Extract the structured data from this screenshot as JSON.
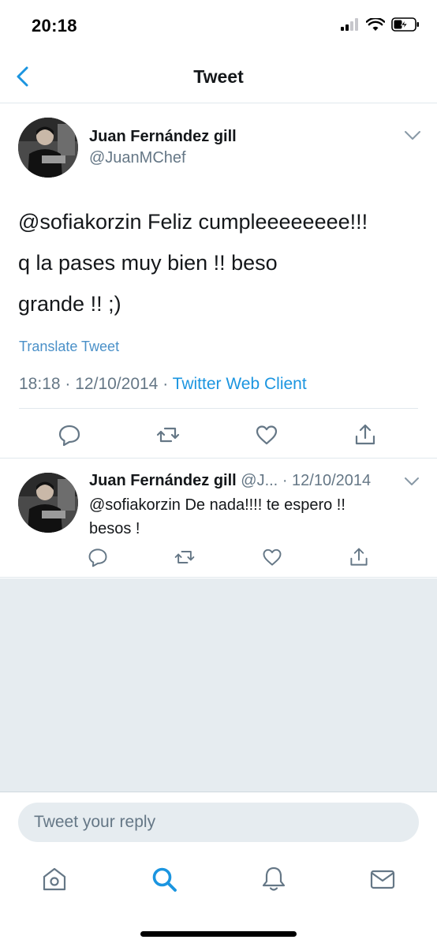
{
  "status_bar": {
    "time": "20:18",
    "battery_percent": 40
  },
  "nav": {
    "title": "Tweet"
  },
  "tweet": {
    "author_name": "Juan Fernández gill",
    "author_handle": "@JuanMChef",
    "text_lines": [
      "@sofiakorzin Feliz cumpleeeeeeee!!!",
      "q la pases muy bien !! beso",
      "grande !! ;)"
    ],
    "translate_label": "Translate Tweet",
    "time": "18:18",
    "separator": "·",
    "date": "12/10/2014",
    "client": "Twitter Web Client"
  },
  "reply": {
    "author_name": "Juan Fernández gill",
    "author_handle": "@J...",
    "date": "· 12/10/2014",
    "text_lines": [
      "@sofiakorzin De nada!!!! te espero !!",
      "besos !"
    ]
  },
  "reply_bar": {
    "placeholder": "Tweet your reply"
  },
  "colors": {
    "accent": "#1b95e0",
    "link": "#4a90c8",
    "secondary_text": "#657786",
    "divider": "#e1e8ed",
    "gray_background": "#e6ecf0",
    "icon_gray": "#657786"
  },
  "icons": {
    "back": "chevron-left-icon",
    "reply": "comment-icon",
    "retweet": "retweet-icon",
    "like": "heart-icon",
    "share": "share-icon",
    "home": "home-icon",
    "search": "search-icon",
    "notifications": "bell-icon",
    "messages": "mail-icon"
  }
}
